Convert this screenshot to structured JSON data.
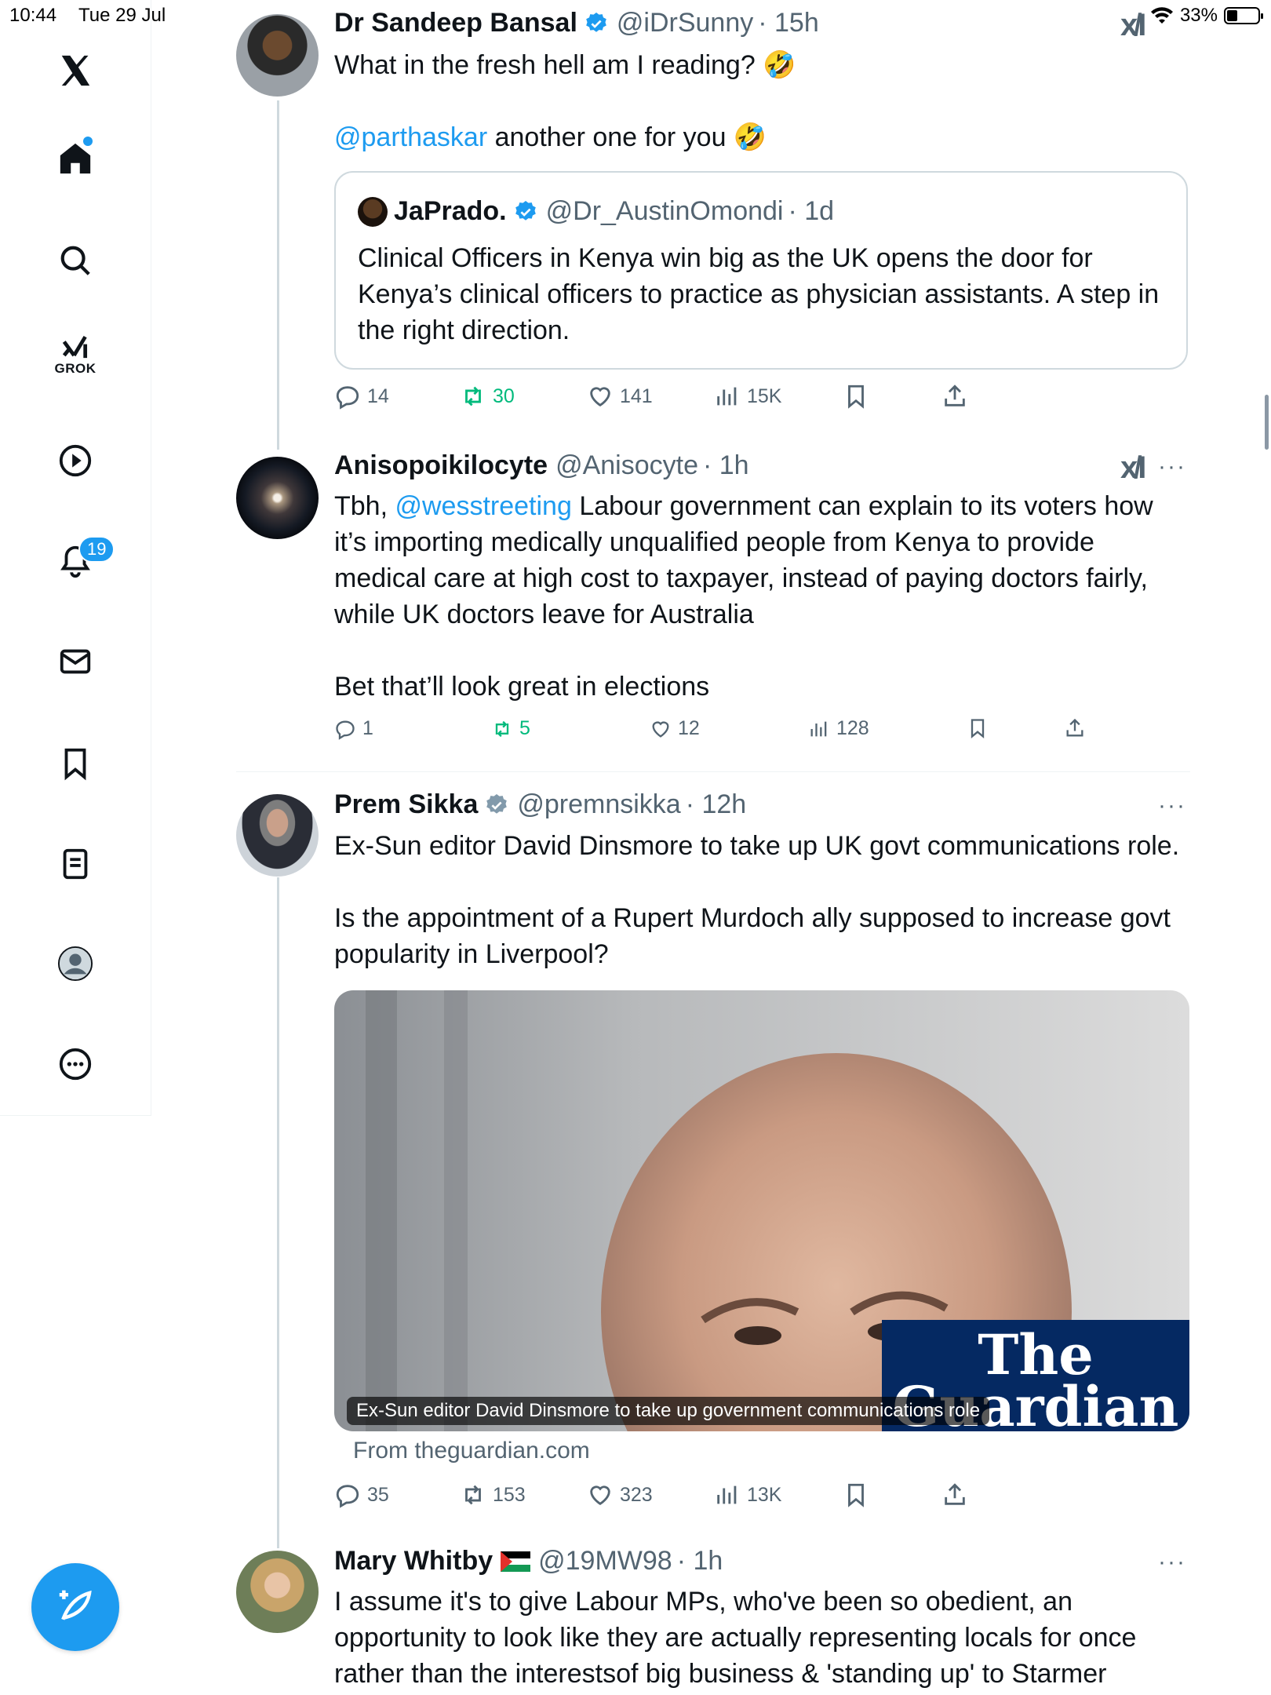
{
  "status": {
    "time": "10:44",
    "date": "Tue 29 Jul",
    "battery": "33%"
  },
  "nav": {
    "grok_label": "GROK",
    "notifications_count": "19",
    "items": [
      "home",
      "search",
      "grok",
      "videos",
      "notifications",
      "messages",
      "bookmarks",
      "lists",
      "profile",
      "more"
    ]
  },
  "tweets": [
    {
      "name": "Dr Sandeep Bansal",
      "handle": "@iDrSunny",
      "time": "· 15h",
      "text1": "What in the fresh hell am I reading? 🤣",
      "mention": "@parthaskar",
      "text2": " another one for you 🤣",
      "quote": {
        "name": "JaPrado.",
        "handle": "@Dr_AustinOmondi",
        "time": "· 1d",
        "text": "Clinical Officers in Kenya win big as the UK opens the door for Kenya’s clinical officers to practice as physician assistants. A step in the right direction."
      },
      "stats": {
        "replies": "14",
        "retweets": "30",
        "likes": "141",
        "views": "15K"
      }
    },
    {
      "name": "Anisopoikilocyte",
      "handle": "@Anisocyte",
      "time": "· 1h",
      "text_prefix": "Tbh, ",
      "mention": "@wesstreeting",
      "text1": " Labour government can explain to its voters how it’s importing medically unqualified people from Kenya to provide medical care at high cost to taxpayer, instead of paying doctors fairly, while UK doctors leave for Australia",
      "text2": "Bet that’ll look great in elections",
      "stats": {
        "replies": "1",
        "retweets": "5",
        "likes": "12",
        "views": "128"
      }
    },
    {
      "name": "Prem Sikka",
      "handle": "@premnsikka",
      "time": "· 12h",
      "text1": "Ex-Sun editor David Dinsmore to take up UK govt communications role.",
      "text2": "Is the appointment of a Rupert Murdoch ally supposed to increase govt popularity in Liverpool?",
      "card": {
        "caption": "Ex-Sun editor David Dinsmore to take up government communications role",
        "source": "From theguardian.com",
        "logo_line1": "The",
        "logo_line2": "Guardian"
      },
      "stats": {
        "replies": "35",
        "retweets": "153",
        "likes": "323",
        "views": "13K"
      }
    },
    {
      "name": "Mary Whitby",
      "handle": "@19MW98",
      "time": "· 1h",
      "text1": "I assume it's to give Labour MPs, who've been so obedient, an opportunity to look like they are actually representing locals for once rather than the interestsof big business & 'standing up' to Starmer"
    }
  ],
  "more_label": "···",
  "xai_mark": "x̸I",
  "colors": {
    "accent": "#1d9bf0",
    "retweet": "#00ba7c",
    "muted": "#536471",
    "border": "#cfd9de"
  }
}
